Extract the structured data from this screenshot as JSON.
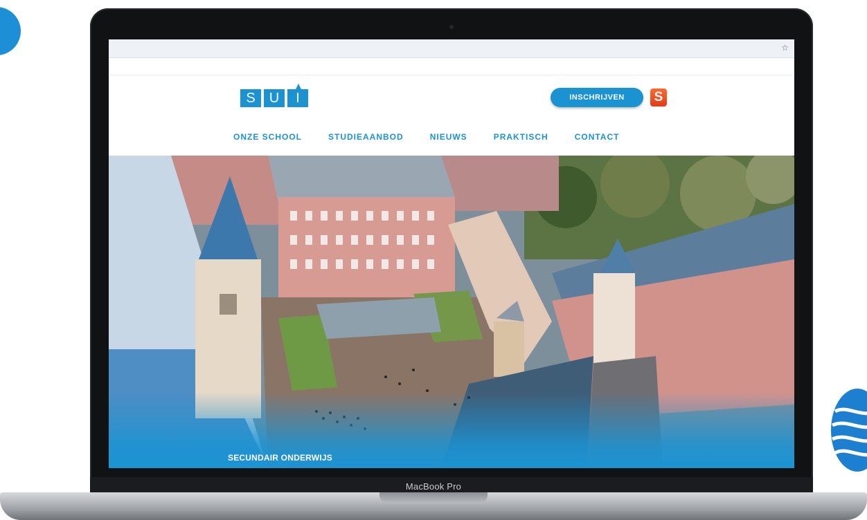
{
  "device": {
    "label": "MacBook Pro"
  },
  "browser": {
    "bookmark_icon": "star-icon"
  },
  "site": {
    "logo_letters": [
      "S",
      "U",
      "I"
    ],
    "cta_label": "INSCHRIJVEN",
    "badge_letter": "S",
    "nav": [
      {
        "label": "ONZE SCHOOL"
      },
      {
        "label": "STUDIEAANBOD"
      },
      {
        "label": "NIEUWS"
      },
      {
        "label": "PRAKTISCH"
      },
      {
        "label": "CONTACT"
      }
    ],
    "hero_caption": "SECUNDAIR ONDERWIJS",
    "colors": {
      "brand": "#1b93d3",
      "badge": "#e8461f"
    }
  }
}
